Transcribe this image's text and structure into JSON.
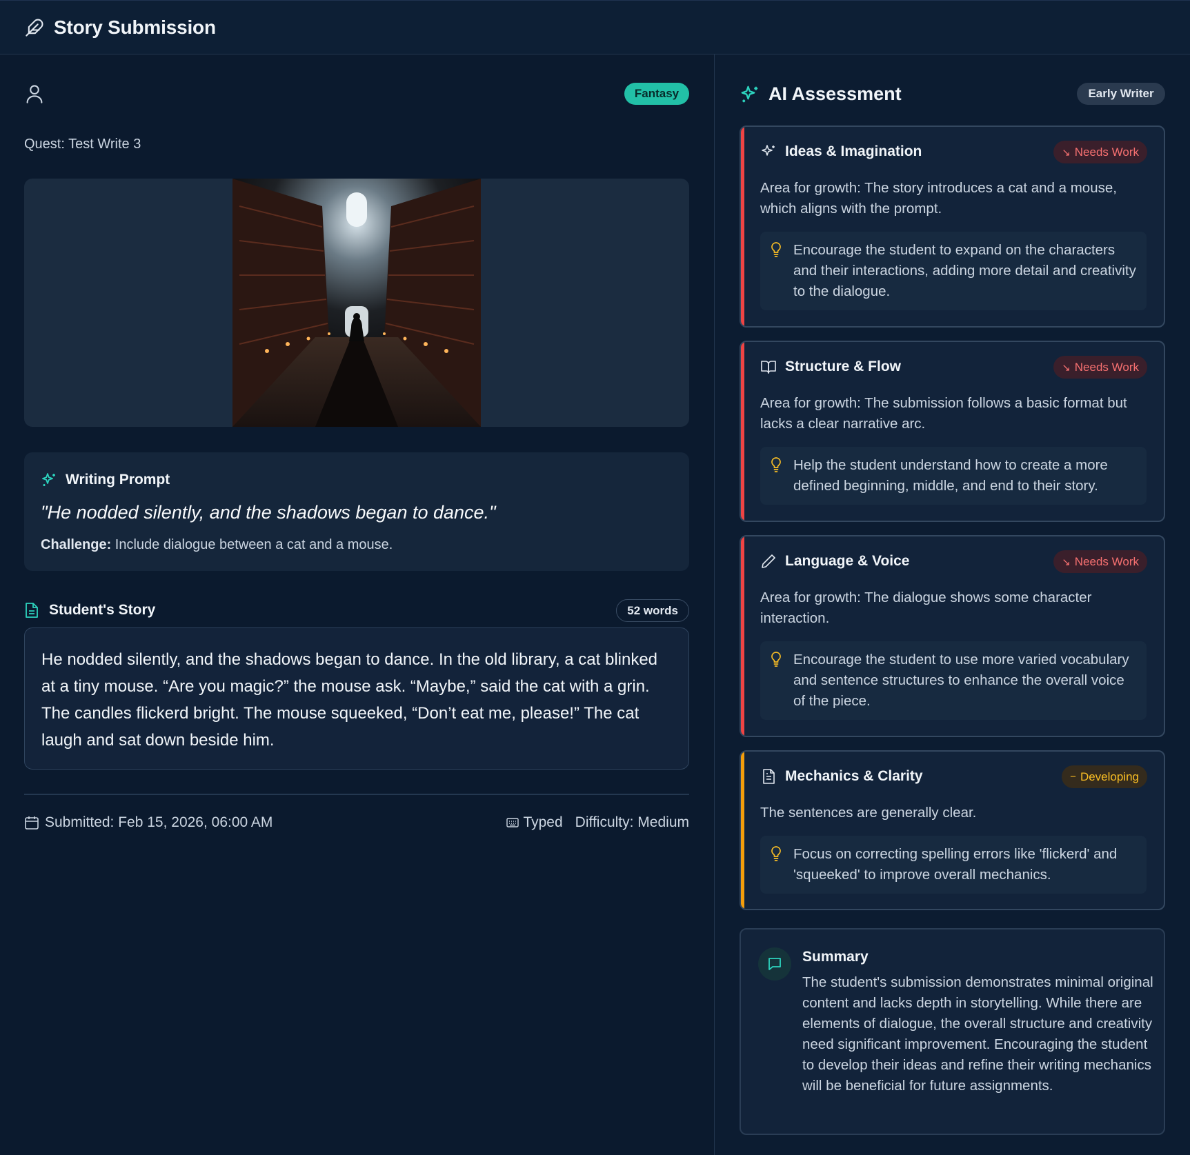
{
  "header": {
    "title": "Story Submission",
    "icon": "feather-icon"
  },
  "submission": {
    "genre": "Fantasy",
    "quest": "Quest: Test Write 3",
    "image_alt": "library-illustration",
    "prompt": {
      "label": "Writing Prompt",
      "quote": "\"He nodded silently, and the shadows began to dance.\"",
      "challenge_label": "Challenge:",
      "challenge_text": " Include dialogue between a cat and a mouse."
    },
    "story": {
      "label": "Student's Story",
      "word_count": "52 words",
      "text": "He nodded silently, and the shadows began to dance. In the old library, a cat blinked at a tiny mouse. “Are you magic?” the mouse ask. “Maybe,” said the cat with a grin. The candles flickerd bright. The mouse squeeked, “Don’t eat me, please!” The cat laugh and sat down beside him."
    },
    "meta": {
      "submitted": "Submitted: Feb 15, 2026, 06:00 AM",
      "input_mode": "Typed",
      "difficulty": "Difficulty: Medium"
    }
  },
  "assessment": {
    "title": "AI Assessment",
    "level": "Early Writer",
    "colors": {
      "needs_work": "#ef4444",
      "developing": "#f59e0b",
      "accent": "#2dd4bf"
    },
    "cards": [
      {
        "title": "Ideas & Imagination",
        "icon": "sparkles-icon",
        "status": "Needs Work",
        "description": "Area for growth: The story introduces a cat and a mouse, which aligns with the prompt.",
        "tip": "Encourage the student to expand on the characters and their interactions, adding more detail and creativity to the dialogue."
      },
      {
        "title": "Structure & Flow",
        "icon": "book-icon",
        "status": "Needs Work",
        "description": "Area for growth: The submission follows a basic format but lacks a clear narrative arc.",
        "tip": "Help the student understand how to create a more defined beginning, middle, and end to their story."
      },
      {
        "title": "Language & Voice",
        "icon": "pencil-icon",
        "status": "Needs Work",
        "description": "Area for growth: The dialogue shows some character interaction.",
        "tip": "Encourage the student to use more varied vocabulary and sentence structures to enhance the overall voice of the piece."
      },
      {
        "title": "Mechanics & Clarity",
        "icon": "document-icon",
        "status": "Developing",
        "description": "The sentences are generally clear.",
        "tip": "Focus on correcting spelling errors like 'flickerd' and 'squeeked' to improve overall mechanics."
      }
    ],
    "summary": {
      "title": "Summary",
      "text": "The student's submission demonstrates minimal original content and lacks depth in storytelling. While there are elements of dialogue, the overall structure and creativity need significant improvement. Encouraging the student to develop their ideas and refine their writing mechanics will be beneficial for future assignments."
    }
  }
}
